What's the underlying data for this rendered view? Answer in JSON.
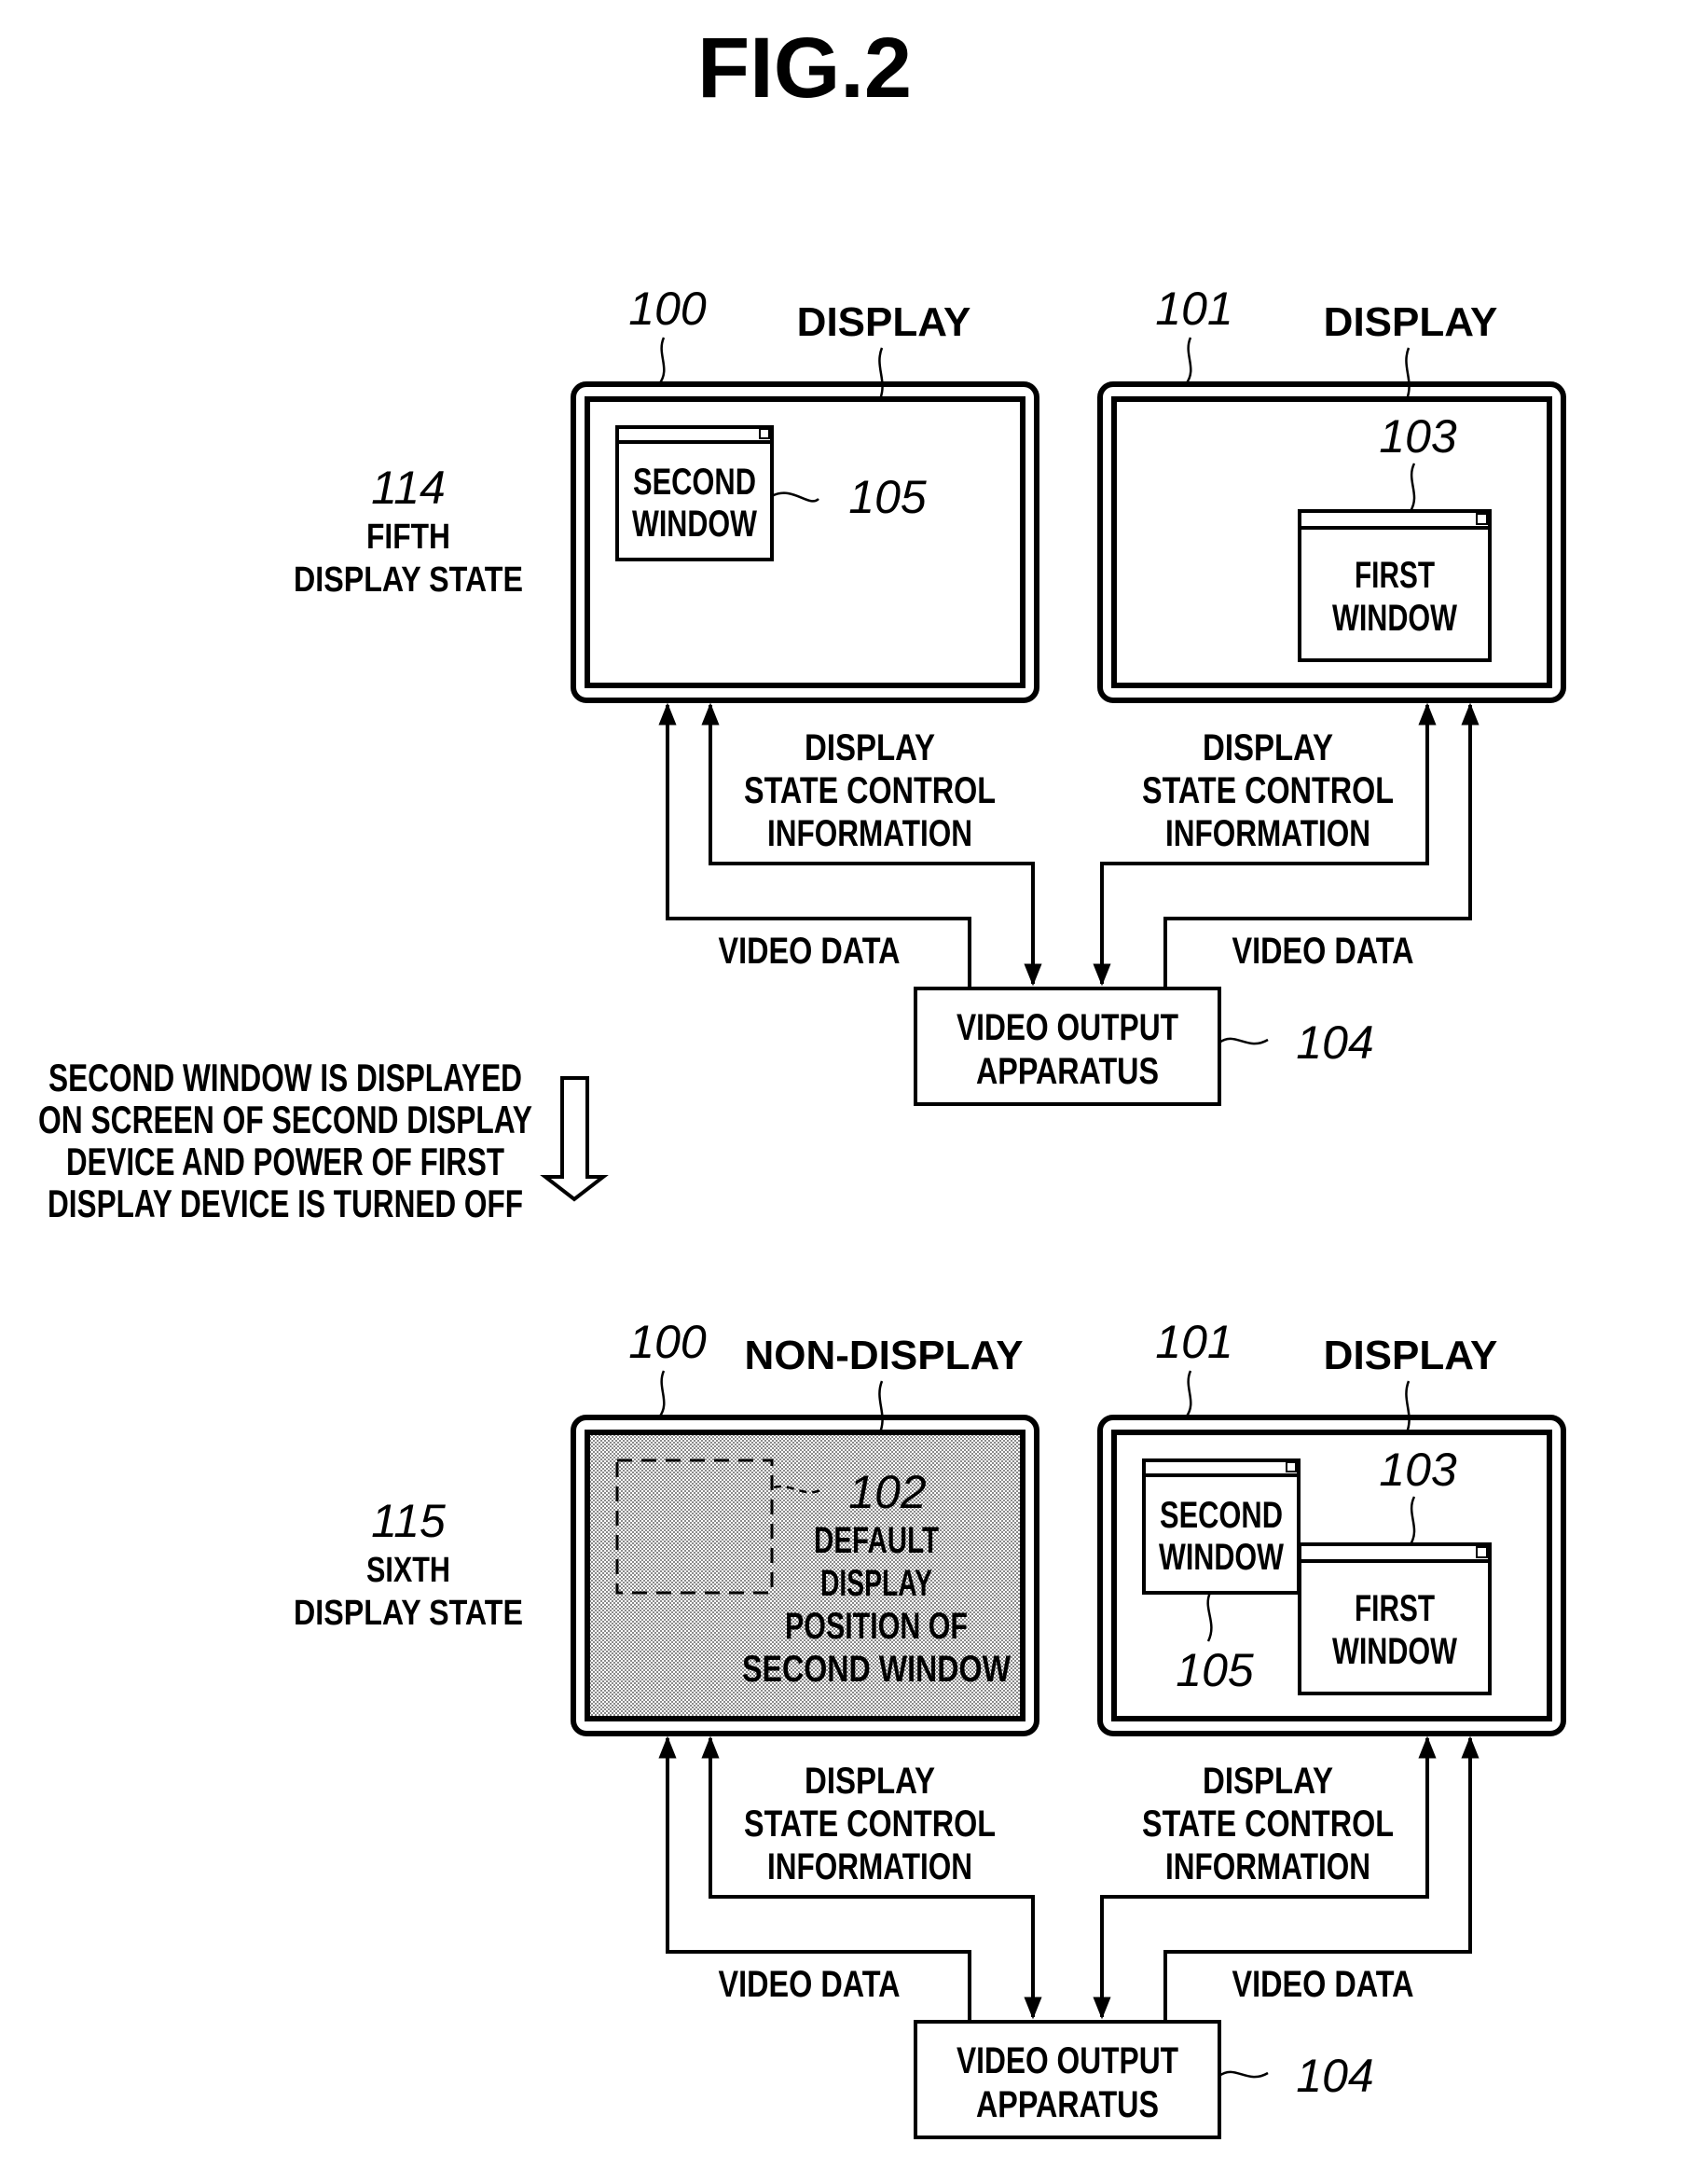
{
  "figure_title": "FIG.2",
  "colors": {
    "ink": "#000000",
    "background": "#ffffff",
    "non_display_fill": "#bdbdbd"
  },
  "transition": {
    "lines": [
      "SECOND WINDOW IS DISPLAYED",
      "ON SCREEN OF SECOND DISPLAY",
      "DEVICE AND POWER OF FIRST",
      "DISPLAY DEVICE IS TURNED OFF"
    ],
    "arrow_icon": "hollow-down-arrow"
  },
  "panels": [
    {
      "state_ref": "114",
      "state_lines": [
        "FIFTH",
        "DISPLAY STATE"
      ],
      "left_display": {
        "ref": "100",
        "status": "DISPLAY",
        "window": {
          "ref": "105",
          "lines": [
            "SECOND",
            "WINDOW"
          ]
        }
      },
      "right_display": {
        "ref": "101",
        "status": "DISPLAY",
        "window": {
          "ref": "103",
          "lines": [
            "FIRST",
            "WINDOW"
          ]
        }
      },
      "control_label_left": [
        "DISPLAY",
        "STATE CONTROL",
        "INFORMATION"
      ],
      "control_label_right": [
        "DISPLAY",
        "STATE CONTROL",
        "INFORMATION"
      ],
      "video_label_left": "VIDEO DATA",
      "video_label_right": "VIDEO DATA",
      "apparatus": {
        "ref": "104",
        "lines": [
          "VIDEO OUTPUT",
          "APPARATUS"
        ]
      }
    },
    {
      "state_ref": "115",
      "state_lines": [
        "SIXTH",
        "DISPLAY STATE"
      ],
      "left_display": {
        "ref": "100",
        "status": "NON-DISPLAY",
        "default_position": {
          "ref": "102",
          "lines": [
            "DEFAULT",
            "DISPLAY",
            "POSITION OF",
            "SECOND WINDOW"
          ]
        }
      },
      "right_display": {
        "ref": "101",
        "status": "DISPLAY",
        "second_window": {
          "ref": "105",
          "lines": [
            "SECOND",
            "WINDOW"
          ]
        },
        "first_window": {
          "ref": "103",
          "lines": [
            "FIRST",
            "WINDOW"
          ]
        }
      },
      "control_label_left": [
        "DISPLAY",
        "STATE CONTROL",
        "INFORMATION"
      ],
      "control_label_right": [
        "DISPLAY",
        "STATE CONTROL",
        "INFORMATION"
      ],
      "video_label_left": "VIDEO DATA",
      "video_label_right": "VIDEO DATA",
      "apparatus": {
        "ref": "104",
        "lines": [
          "VIDEO OUTPUT",
          "APPARATUS"
        ]
      }
    }
  ]
}
